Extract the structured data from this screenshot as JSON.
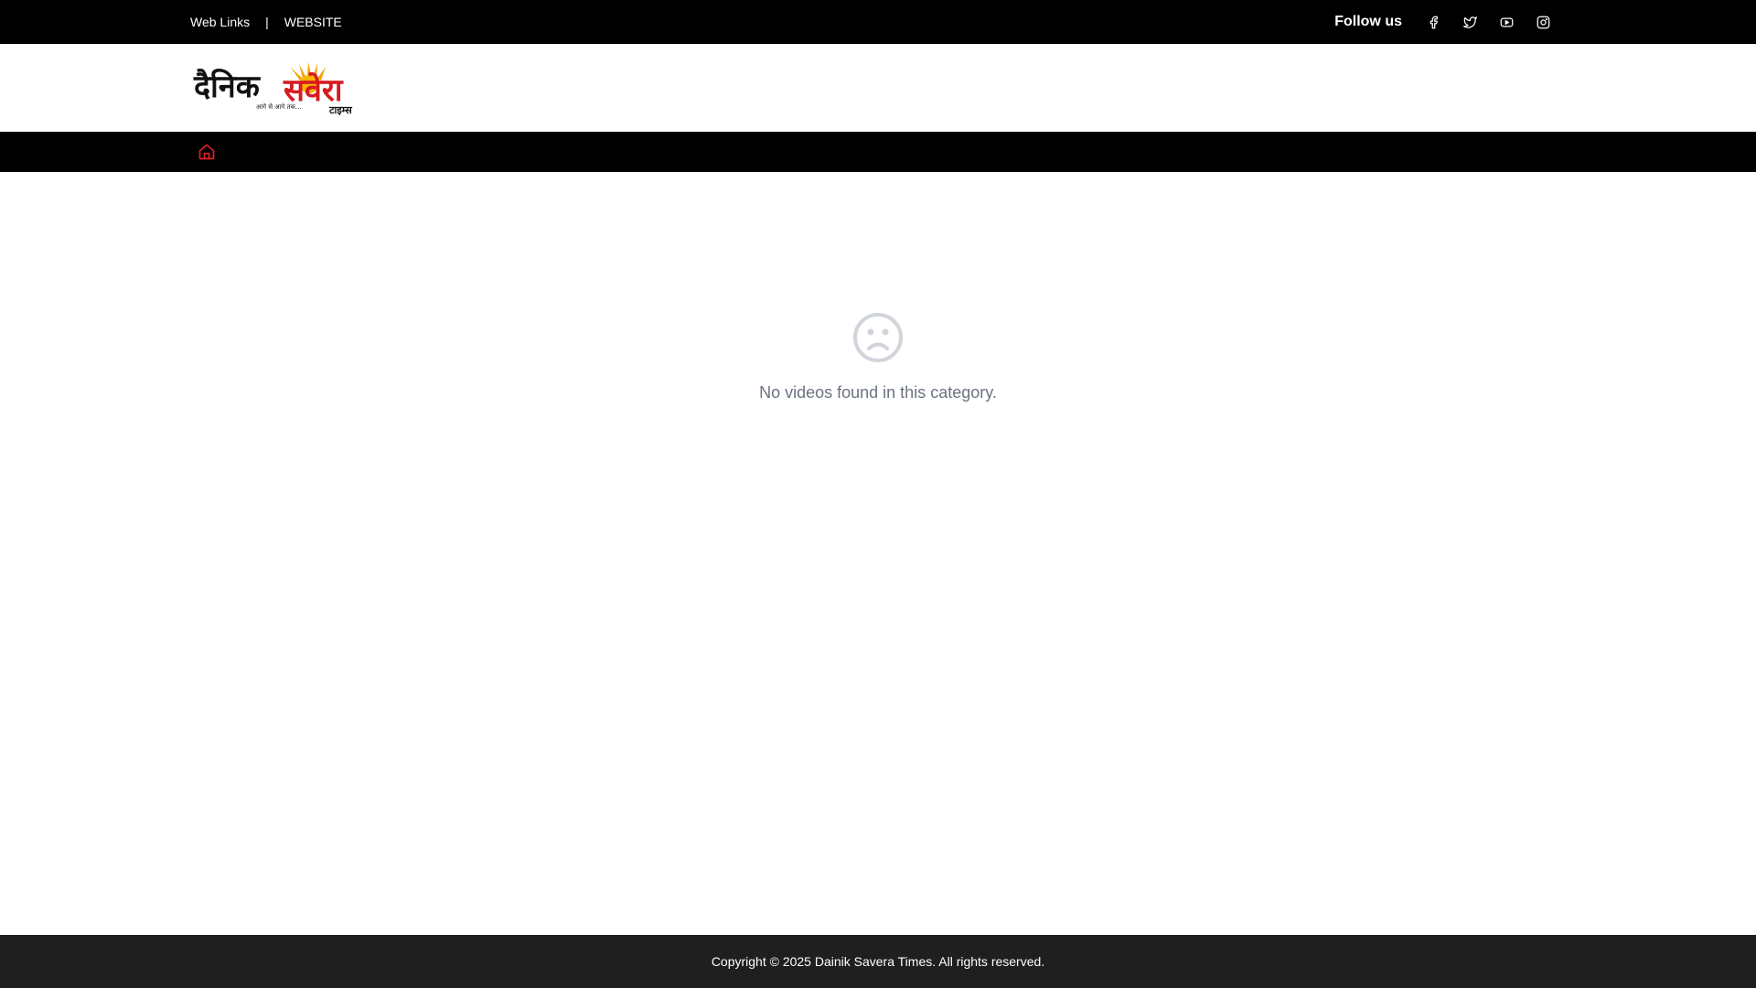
{
  "topbar": {
    "links": [
      "Web Links",
      "WEBSITE"
    ],
    "separator": "|",
    "follow_label": "Follow us",
    "social_icons": [
      "facebook-icon",
      "twitter-icon",
      "youtube-icon",
      "instagram-icon"
    ]
  },
  "logo": {
    "alt": "Dainik Savera Times",
    "wordmark_left": "दैनिक",
    "wordmark_right": "सवेरा",
    "tagline": "आगे से आगे तक...",
    "sub": "टाइम्स"
  },
  "nav": {
    "home_icon": "home-icon",
    "accent_color": "#e11d2a"
  },
  "empty_state": {
    "icon": "sad-face-icon",
    "message": "No videos found in this category."
  },
  "footer": {
    "copyright": "Copyright © 2025 Dainik Savera Times. All rights reserved."
  },
  "colors": {
    "topbar_bg": "#000000",
    "nav_bg": "#000000",
    "footer_bg": "#1f1f1f",
    "empty_text": "#6b7280",
    "logo_red": "#d71920",
    "logo_black": "#111111"
  }
}
